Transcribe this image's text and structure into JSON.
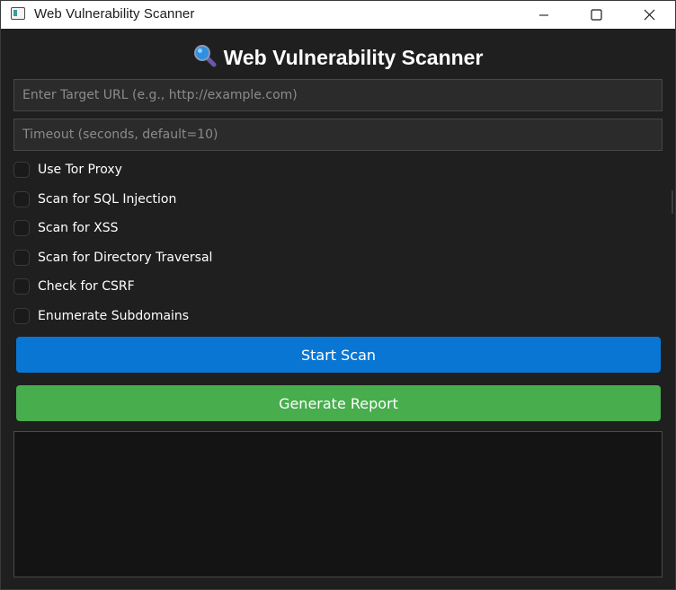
{
  "window": {
    "title": "Web Vulnerability Scanner"
  },
  "app": {
    "heading": "Web Vulnerability Scanner",
    "heading_icon": "magnifying-glass-icon"
  },
  "inputs": {
    "url": {
      "placeholder": "Enter Target URL (e.g., http://example.com)",
      "value": ""
    },
    "timeout": {
      "placeholder": "Timeout (seconds, default=10)",
      "value": ""
    }
  },
  "options": [
    {
      "label": "Use Tor Proxy",
      "checked": false
    },
    {
      "label": "Scan for SQL Injection",
      "checked": false
    },
    {
      "label": "Scan for XSS",
      "checked": false
    },
    {
      "label": "Scan for Directory Traversal",
      "checked": false
    },
    {
      "label": "Check for CSRF",
      "checked": false
    },
    {
      "label": "Enumerate Subdomains",
      "checked": false
    }
  ],
  "buttons": {
    "start_scan": "Start Scan",
    "generate_report": "Generate Report"
  },
  "output": {
    "text": ""
  },
  "colors": {
    "background": "#1f1f1f",
    "start_scan": "#0a76d4",
    "generate_report": "#47ad4d",
    "output_bg": "#141414"
  }
}
